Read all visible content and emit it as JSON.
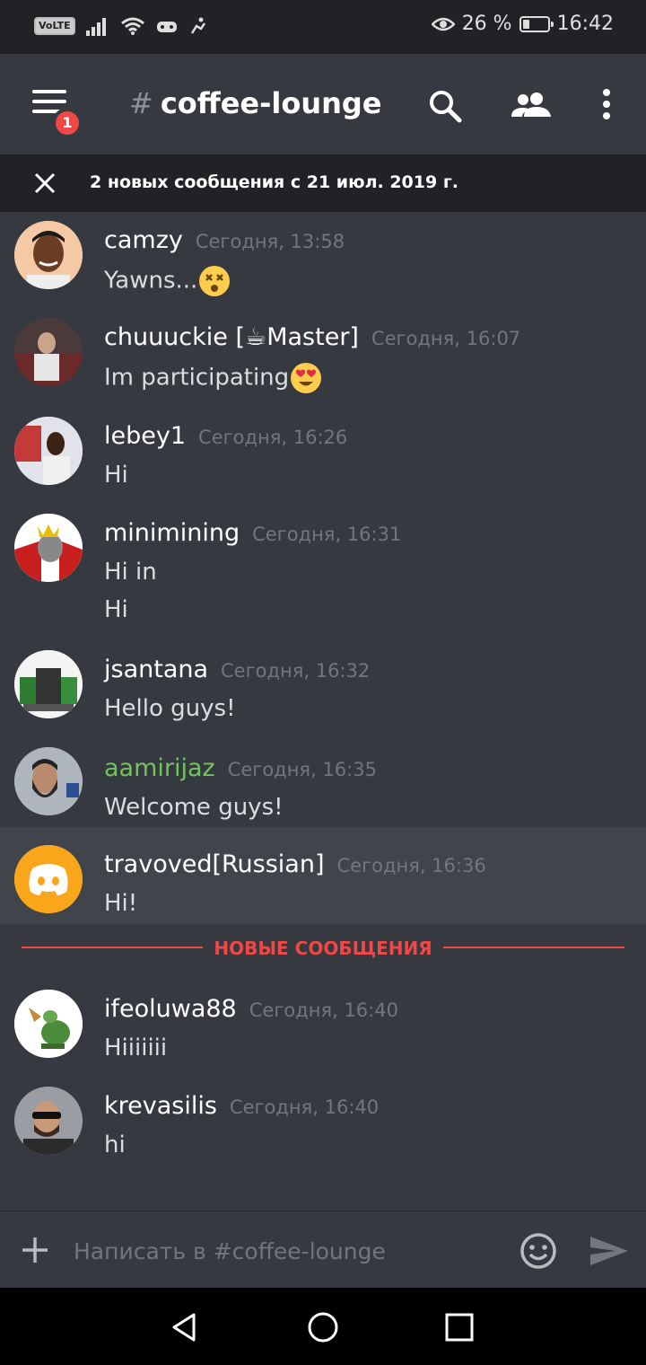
{
  "status_bar": {
    "battery_percent": 26,
    "battery_text": "26 %",
    "time": "16:42",
    "volte": "VoLTE"
  },
  "header": {
    "hash": "#",
    "channel": "coffee-lounge",
    "badge_count": "1"
  },
  "banner": {
    "text": "2 новых сообщения с 21 июл. 2019 г."
  },
  "messages": [
    {
      "user": "camzy",
      "time": "Сегодня, 13:58",
      "lines": [
        "Yawns..."
      ],
      "emoji": "dizzy-face"
    },
    {
      "user": "chuuuckie [☕Master]",
      "time": "Сегодня, 16:07",
      "lines": [
        "Im participating"
      ],
      "emoji": "heart-eyes"
    },
    {
      "user": "lebey1",
      "time": "Сегодня, 16:26",
      "lines": [
        "Hi"
      ]
    },
    {
      "user": "minimining",
      "time": "Сегодня, 16:31",
      "lines": [
        "Hi in",
        "Hi"
      ]
    },
    {
      "user": "jsantana",
      "time": "Сегодня, 16:32",
      "lines": [
        "Hello guys!"
      ]
    },
    {
      "user": "aamirijaz",
      "time": "Сегодня, 16:35",
      "lines": [
        "Welcome guys!"
      ],
      "name_color": "#71c45f"
    },
    {
      "user": "travoved[Russian]",
      "time": "Сегодня, 16:36",
      "lines": [
        "Hi!"
      ],
      "highlighted": true
    },
    {
      "user": "ifeoluwa88",
      "time": "Сегодня, 16:40",
      "lines": [
        "Hiiiiiii"
      ]
    },
    {
      "user": "krevasilis",
      "time": "Сегодня, 16:40",
      "lines": [
        "hi"
      ]
    }
  ],
  "new_messages_divider": "НОВЫЕ СООБЩЕНИЯ",
  "composer": {
    "placeholder": "Написать в #coffee-lounge"
  },
  "colors": {
    "background": "#36393f",
    "dark": "#202225",
    "accent_red": "#f04747",
    "discord_orange": "#faa61a",
    "username_green": "#71c45f"
  }
}
